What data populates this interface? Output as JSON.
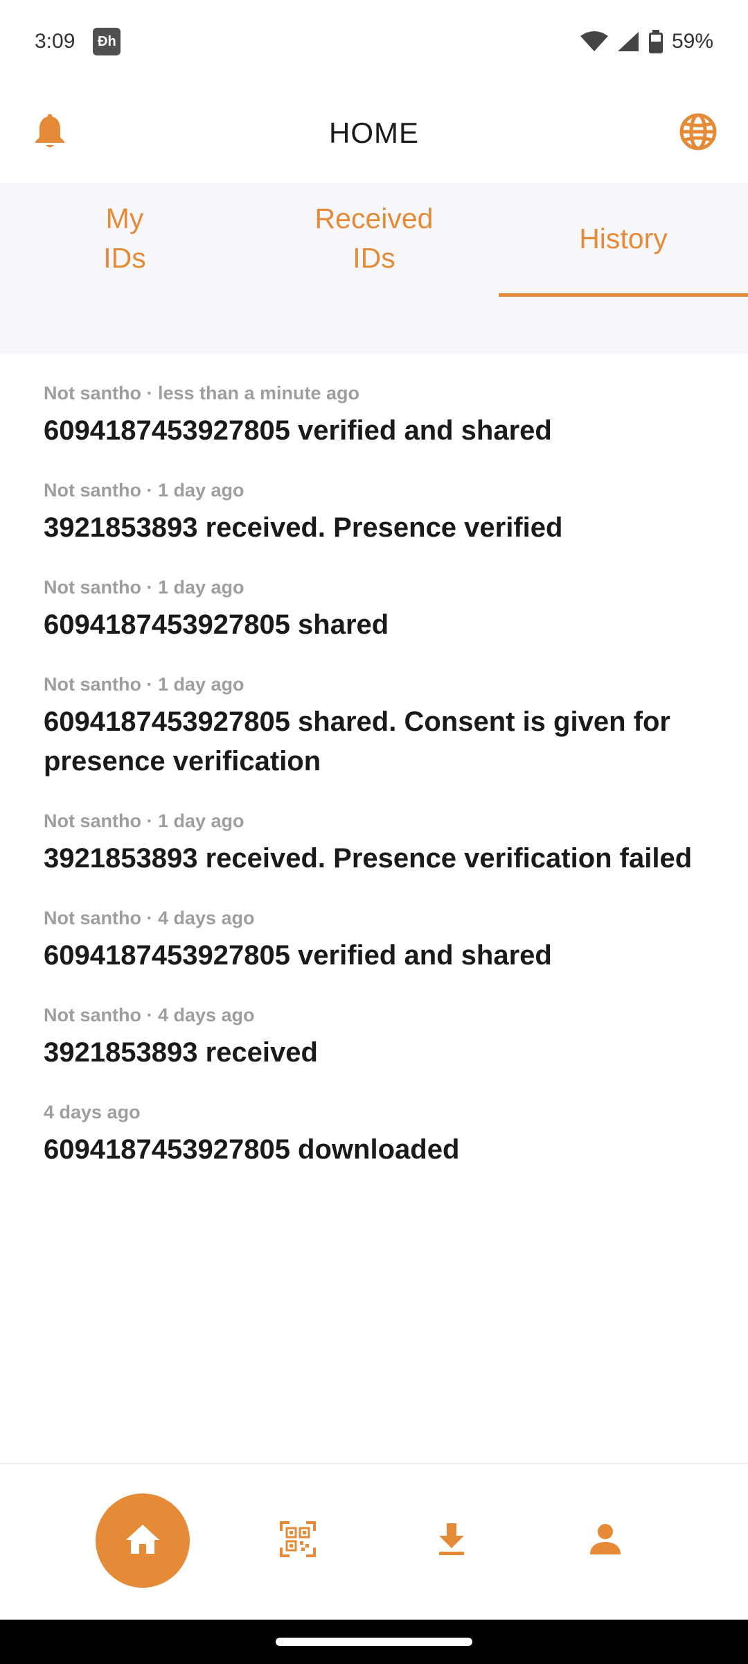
{
  "status_bar": {
    "time": "3:09",
    "app_icon_text": "Ðh",
    "battery": "59%"
  },
  "header": {
    "title": "HOME",
    "left_icon": "bell-icon",
    "right_icon": "globe-icon"
  },
  "tabs": [
    {
      "label": "My\nIDs",
      "active": false
    },
    {
      "label": "Received\nIDs",
      "active": false
    },
    {
      "label": "History",
      "active": true
    }
  ],
  "history": [
    {
      "meta": "Not santho · less than a minute ago",
      "text": "6094187453927805 verified and shared"
    },
    {
      "meta": "Not santho · 1 day ago",
      "text": "3921853893 received. Presence verified"
    },
    {
      "meta": "Not santho · 1 day ago",
      "text": "6094187453927805 shared"
    },
    {
      "meta": "Not santho · 1 day ago",
      "text": "6094187453927805 shared. Consent is given for presence verification"
    },
    {
      "meta": "Not santho · 1 day ago",
      "text": "3921853893 received. Presence verification failed"
    },
    {
      "meta": "Not santho · 4 days ago",
      "text": "6094187453927805 verified and shared"
    },
    {
      "meta": "Not santho · 4 days ago",
      "text": "3921853893 received"
    },
    {
      "meta": "4 days ago",
      "text": "6094187453927805 downloaded"
    }
  ],
  "bottom_nav": [
    {
      "icon": "home-icon",
      "active": true
    },
    {
      "icon": "qr-scan-icon",
      "active": false
    },
    {
      "icon": "download-icon",
      "active": false
    },
    {
      "icon": "profile-icon",
      "active": false
    }
  ],
  "colors": {
    "accent": "#e58a37",
    "tab_bg": "#f7f7fc",
    "meta_text": "#9e9e9e"
  }
}
